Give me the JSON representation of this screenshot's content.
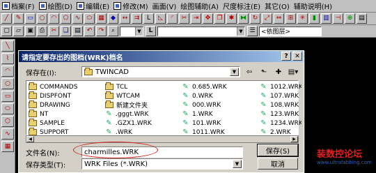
{
  "menubar": {
    "items": [
      {
        "label": "档案(F)",
        "icon": "file-menu-icon"
      },
      {
        "label": "绘图(D)",
        "icon": "draw-menu-icon"
      },
      {
        "label": "编辑(E)",
        "icon": "edit-menu-icon"
      },
      {
        "label": "修改(M)",
        "icon": "modify-menu-icon"
      },
      {
        "label": "画面(V)",
        "icon": "view-menu-icon"
      },
      {
        "label": "绘图辅助(A)",
        "icon": "assist-menu-icon"
      },
      {
        "label": "尺度标注(E)",
        "icon": "dim-menu-icon"
      },
      {
        "label": "其它(O)",
        "icon": "other-menu-icon"
      },
      {
        "label": "辅助说明(H)",
        "icon": "help-menu-icon"
      }
    ]
  },
  "toolbar2": {
    "layer_select": "",
    "layer_label": "L",
    "linetype_select": "",
    "bylayer_label": "<依图层>"
  },
  "dialog": {
    "title": "请指定要存出的图档(WRK)档名",
    "save_in_label": "保存在(I):",
    "save_in_value": "TWINCAD",
    "files": [
      {
        "name": "COMMANDS",
        "type": "folder"
      },
      {
        "name": "TCL",
        "type": "folder"
      },
      {
        "name": "0.685.WRK",
        "type": "file"
      },
      {
        "name": "1012.WRK",
        "type": "file"
      },
      {
        "name": "DISPFONT",
        "type": "folder"
      },
      {
        "name": "WTCAM",
        "type": "folder"
      },
      {
        "name": "0.WRK",
        "type": "file"
      },
      {
        "name": "107.WRK",
        "type": "file"
      },
      {
        "name": "DRAWING",
        "type": "folder"
      },
      {
        "name": "新建文件夹",
        "type": "folder"
      },
      {
        "name": "000.WRK",
        "type": "file"
      },
      {
        "name": "108.WRK",
        "type": "file"
      },
      {
        "name": "NT",
        "type": "folder"
      },
      {
        "name": ".gggt.WRK",
        "type": "file"
      },
      {
        "name": "1.WRK",
        "type": "file"
      },
      {
        "name": "123.WRK",
        "type": "file"
      },
      {
        "name": "SAMPLE",
        "type": "folder"
      },
      {
        "name": ".GZX1.WRK",
        "type": "file"
      },
      {
        "name": "101.WRK",
        "type": "file"
      },
      {
        "name": "1234.WRK",
        "type": "file"
      },
      {
        "name": "SUPPORT",
        "type": "folder"
      },
      {
        "name": ".WRK",
        "type": "file"
      },
      {
        "name": "1011.WRK",
        "type": "file"
      },
      {
        "name": "2.WRK",
        "type": "file"
      }
    ],
    "filename_label": "文件名(N):",
    "filename_value": "charmilles.WRK",
    "filetype_label": "保存类型(T):",
    "filetype_value": "WRK Files (*.WRK)",
    "save_button": "保存(S)",
    "cancel_button": "取消"
  },
  "watermark": {
    "main": "装数控论坛",
    "sub": "www.ultrafabbing.com"
  }
}
